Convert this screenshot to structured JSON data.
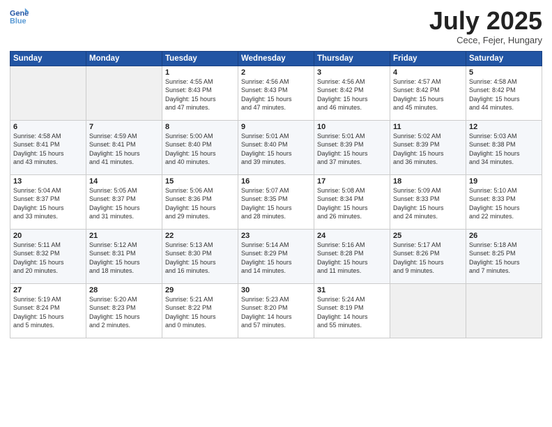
{
  "header": {
    "logo_line1": "General",
    "logo_line2": "Blue",
    "month": "July 2025",
    "location": "Cece, Fejer, Hungary"
  },
  "columns": [
    "Sunday",
    "Monday",
    "Tuesday",
    "Wednesday",
    "Thursday",
    "Friday",
    "Saturday"
  ],
  "weeks": [
    [
      {
        "day": "",
        "info": ""
      },
      {
        "day": "",
        "info": ""
      },
      {
        "day": "1",
        "info": "Sunrise: 4:55 AM\nSunset: 8:43 PM\nDaylight: 15 hours\nand 47 minutes."
      },
      {
        "day": "2",
        "info": "Sunrise: 4:56 AM\nSunset: 8:43 PM\nDaylight: 15 hours\nand 47 minutes."
      },
      {
        "day": "3",
        "info": "Sunrise: 4:56 AM\nSunset: 8:42 PM\nDaylight: 15 hours\nand 46 minutes."
      },
      {
        "day": "4",
        "info": "Sunrise: 4:57 AM\nSunset: 8:42 PM\nDaylight: 15 hours\nand 45 minutes."
      },
      {
        "day": "5",
        "info": "Sunrise: 4:58 AM\nSunset: 8:42 PM\nDaylight: 15 hours\nand 44 minutes."
      }
    ],
    [
      {
        "day": "6",
        "info": "Sunrise: 4:58 AM\nSunset: 8:41 PM\nDaylight: 15 hours\nand 43 minutes."
      },
      {
        "day": "7",
        "info": "Sunrise: 4:59 AM\nSunset: 8:41 PM\nDaylight: 15 hours\nand 41 minutes."
      },
      {
        "day": "8",
        "info": "Sunrise: 5:00 AM\nSunset: 8:40 PM\nDaylight: 15 hours\nand 40 minutes."
      },
      {
        "day": "9",
        "info": "Sunrise: 5:01 AM\nSunset: 8:40 PM\nDaylight: 15 hours\nand 39 minutes."
      },
      {
        "day": "10",
        "info": "Sunrise: 5:01 AM\nSunset: 8:39 PM\nDaylight: 15 hours\nand 37 minutes."
      },
      {
        "day": "11",
        "info": "Sunrise: 5:02 AM\nSunset: 8:39 PM\nDaylight: 15 hours\nand 36 minutes."
      },
      {
        "day": "12",
        "info": "Sunrise: 5:03 AM\nSunset: 8:38 PM\nDaylight: 15 hours\nand 34 minutes."
      }
    ],
    [
      {
        "day": "13",
        "info": "Sunrise: 5:04 AM\nSunset: 8:37 PM\nDaylight: 15 hours\nand 33 minutes."
      },
      {
        "day": "14",
        "info": "Sunrise: 5:05 AM\nSunset: 8:37 PM\nDaylight: 15 hours\nand 31 minutes."
      },
      {
        "day": "15",
        "info": "Sunrise: 5:06 AM\nSunset: 8:36 PM\nDaylight: 15 hours\nand 29 minutes."
      },
      {
        "day": "16",
        "info": "Sunrise: 5:07 AM\nSunset: 8:35 PM\nDaylight: 15 hours\nand 28 minutes."
      },
      {
        "day": "17",
        "info": "Sunrise: 5:08 AM\nSunset: 8:34 PM\nDaylight: 15 hours\nand 26 minutes."
      },
      {
        "day": "18",
        "info": "Sunrise: 5:09 AM\nSunset: 8:33 PM\nDaylight: 15 hours\nand 24 minutes."
      },
      {
        "day": "19",
        "info": "Sunrise: 5:10 AM\nSunset: 8:33 PM\nDaylight: 15 hours\nand 22 minutes."
      }
    ],
    [
      {
        "day": "20",
        "info": "Sunrise: 5:11 AM\nSunset: 8:32 PM\nDaylight: 15 hours\nand 20 minutes."
      },
      {
        "day": "21",
        "info": "Sunrise: 5:12 AM\nSunset: 8:31 PM\nDaylight: 15 hours\nand 18 minutes."
      },
      {
        "day": "22",
        "info": "Sunrise: 5:13 AM\nSunset: 8:30 PM\nDaylight: 15 hours\nand 16 minutes."
      },
      {
        "day": "23",
        "info": "Sunrise: 5:14 AM\nSunset: 8:29 PM\nDaylight: 15 hours\nand 14 minutes."
      },
      {
        "day": "24",
        "info": "Sunrise: 5:16 AM\nSunset: 8:28 PM\nDaylight: 15 hours\nand 11 minutes."
      },
      {
        "day": "25",
        "info": "Sunrise: 5:17 AM\nSunset: 8:26 PM\nDaylight: 15 hours\nand 9 minutes."
      },
      {
        "day": "26",
        "info": "Sunrise: 5:18 AM\nSunset: 8:25 PM\nDaylight: 15 hours\nand 7 minutes."
      }
    ],
    [
      {
        "day": "27",
        "info": "Sunrise: 5:19 AM\nSunset: 8:24 PM\nDaylight: 15 hours\nand 5 minutes."
      },
      {
        "day": "28",
        "info": "Sunrise: 5:20 AM\nSunset: 8:23 PM\nDaylight: 15 hours\nand 2 minutes."
      },
      {
        "day": "29",
        "info": "Sunrise: 5:21 AM\nSunset: 8:22 PM\nDaylight: 15 hours\nand 0 minutes."
      },
      {
        "day": "30",
        "info": "Sunrise: 5:23 AM\nSunset: 8:20 PM\nDaylight: 14 hours\nand 57 minutes."
      },
      {
        "day": "31",
        "info": "Sunrise: 5:24 AM\nSunset: 8:19 PM\nDaylight: 14 hours\nand 55 minutes."
      },
      {
        "day": "",
        "info": ""
      },
      {
        "day": "",
        "info": ""
      }
    ]
  ]
}
